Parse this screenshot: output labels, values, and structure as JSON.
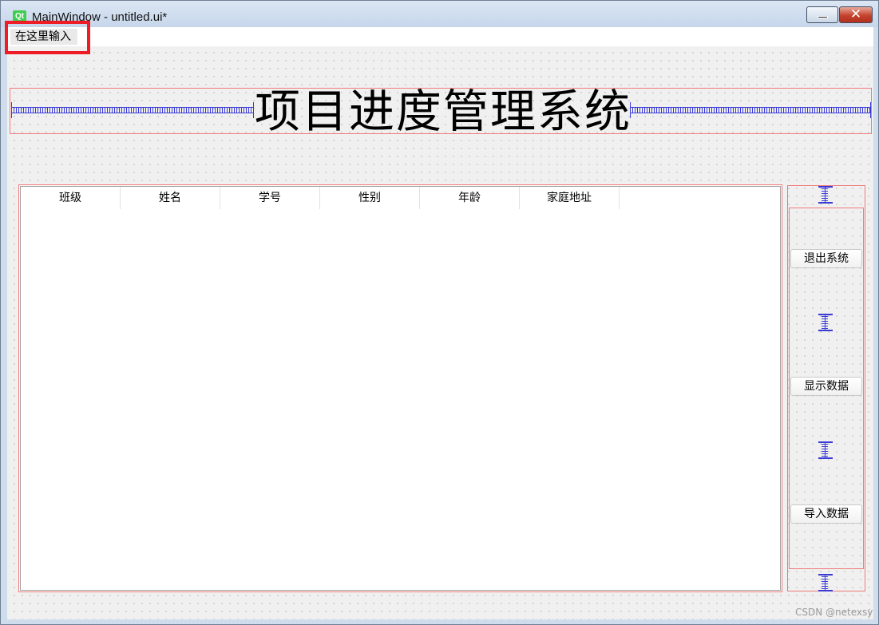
{
  "window": {
    "app_icon_text": "Qt",
    "title": "MainWindow - untitled.ui*",
    "minimize_symbol": "—",
    "close_symbol": "✕"
  },
  "menubar": {
    "placeholder_item": "在这里输入"
  },
  "main": {
    "title": "项目进度管理系统",
    "table": {
      "columns": [
        "班级",
        "姓名",
        "学号",
        "性别",
        "年龄",
        "家庭地址"
      ],
      "rows": []
    },
    "buttons": {
      "exit": "退出系统",
      "show_data": "显示数据",
      "import_data": "导入数据"
    }
  },
  "watermark": "CSDN @netexsy",
  "colors": {
    "layout_border": "#f07a7a",
    "spacer": "#3a3ad6",
    "annotation_box": "#ee1c24"
  }
}
